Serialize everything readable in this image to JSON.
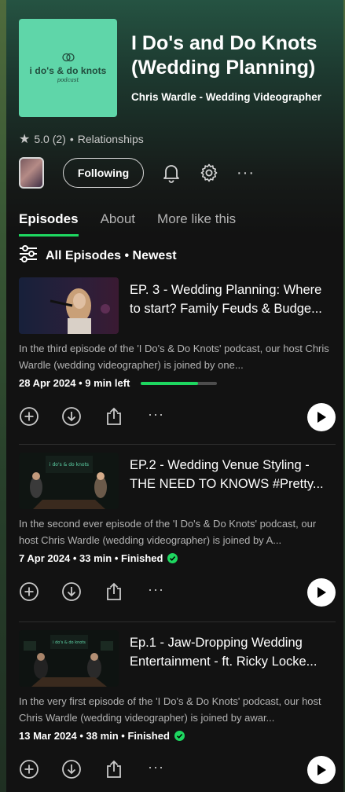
{
  "podcast": {
    "cover_title": "i do's & do knots",
    "cover_subtitle": "podcast",
    "title": "I Do's and Do Knots (Wedding Planning)",
    "author": "Chris Wardle - Wedding Videographer",
    "rating": "5.0 (2)",
    "category": "Relationships"
  },
  "actions": {
    "following_label": "Following"
  },
  "tabs": [
    {
      "label": "Episodes"
    },
    {
      "label": "About"
    },
    {
      "label": "More like this"
    }
  ],
  "filter": {
    "label": "All Episodes • Newest"
  },
  "episodes": [
    {
      "title": "EP. 3 - Wedding Planning: Where to start? Family Feuds & Budge...",
      "description": "In the third episode of the 'I Do's & Do Knots' podcast, our host Chris Wardle (wedding videographer) is joined by one...",
      "meta": "28 Apr 2024 • 9 min left",
      "progress": 0.75,
      "finished": false
    },
    {
      "title": "EP.2 - Wedding Venue Styling - THE NEED TO KNOWS #Pretty...",
      "description": "In the second ever episode of the 'I Do's & Do Knots' podcast, our host Chris Wardle (wedding videographer) is joined by A...",
      "meta": "7 Apr 2024 • 33 min • Finished",
      "finished": true
    },
    {
      "title": "Ep.1 - Jaw-Dropping Wedding Entertainment - ft. Ricky Locke...",
      "description": "In the very first episode of the 'I Do's & Do Knots' podcast, our host Chris Wardle (wedding videographer) is joined by awar...",
      "meta": "13 Mar 2024 • 38 min • Finished",
      "finished": true
    }
  ],
  "colors": {
    "accent": "#1ed760",
    "cover": "#5fd6a9",
    "background": "#121212"
  }
}
